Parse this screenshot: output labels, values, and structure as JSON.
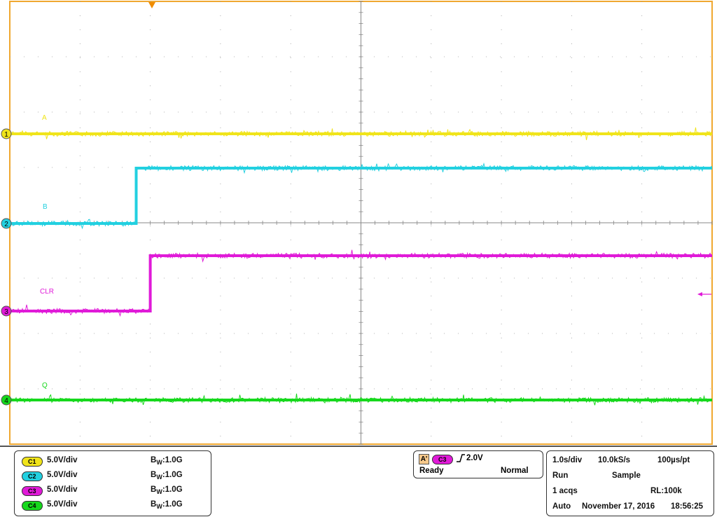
{
  "colors": {
    "ch1": "#f0e41a",
    "ch2": "#22d0e0",
    "ch3": "#e01ad8",
    "ch4": "#16d81c",
    "grid_border": "#f0a830",
    "grid_line": "#9a9a9a",
    "trigger_marker": "#f08c00"
  },
  "screen": {
    "markers": {
      "ch1": "1",
      "ch2": "2",
      "ch3": "3",
      "ch4": "4"
    },
    "trace_labels": {
      "ch1": "A",
      "ch2": "B",
      "ch3": "CLR",
      "ch4": "Q"
    },
    "trigger_position_icon": "triangle-down-icon",
    "trigger_level_icon": "arrow-left-icon"
  },
  "chart_data": {
    "type": "line",
    "xlabel": "",
    "ylabel": "",
    "grid": true,
    "divisions": {
      "x": 10,
      "y": 8
    },
    "series": [
      {
        "name": "A",
        "channel": 1,
        "x": [
          0,
          10
        ],
        "y": [
          0,
          0
        ]
      },
      {
        "name": "B",
        "channel": 2,
        "x": [
          0,
          1.8,
          1.8,
          10
        ],
        "y": [
          0,
          0,
          5,
          5
        ]
      },
      {
        "name": "CLR",
        "channel": 3,
        "x": [
          0,
          2.0,
          2.0,
          10
        ],
        "y": [
          0,
          0,
          5,
          5
        ]
      },
      {
        "name": "Q",
        "channel": 4,
        "x": [
          0,
          10
        ],
        "y": [
          0,
          0
        ]
      }
    ]
  },
  "status": {
    "channels": [
      {
        "chip": "C1",
        "scale": "5.0V/div",
        "bw_prefix": "B",
        "bw_sub": "W",
        "bw_value": ":1.0G"
      },
      {
        "chip": "C2",
        "scale": "5.0V/div",
        "bw_prefix": "B",
        "bw_sub": "W",
        "bw_value": ":1.0G"
      },
      {
        "chip": "C3",
        "scale": "5.0V/div",
        "bw_prefix": "B",
        "bw_sub": "W",
        "bw_value": ":1.0G"
      },
      {
        "chip": "C4",
        "scale": "5.0V/div",
        "bw_prefix": "B",
        "bw_sub": "W",
        "bw_value": ":1.0G"
      }
    ],
    "trigger": {
      "mode": "A'",
      "source": "C3",
      "edge_icon": "rising-edge-icon",
      "level": "2.0V",
      "state": "Ready",
      "type": "Normal"
    },
    "acquisition": {
      "timebase": "1.0s/div",
      "sample_rate": "10.0kS/s",
      "resolution": "100µs/pt",
      "run_state": "Run",
      "mode": "Sample",
      "acqs": "1 acqs",
      "record_length": "RL:100k",
      "trigger_mode": "Auto",
      "date": "November 17, 2016",
      "time": "18:56:25"
    }
  }
}
